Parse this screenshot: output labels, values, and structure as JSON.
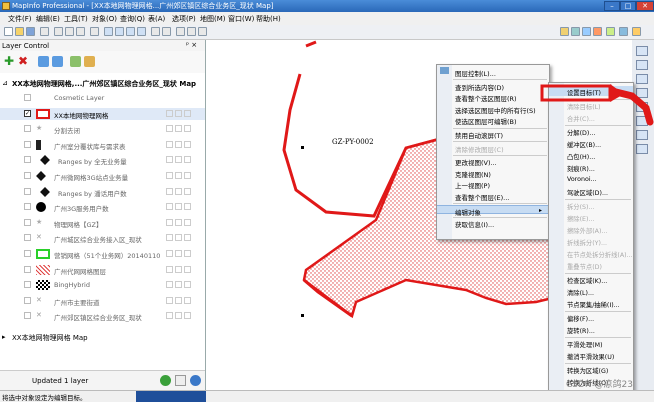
{
  "window": {
    "title": "MapInfo Professional - [XX本地网物理网格...广州郊区镇区综合业务区_现状 Map]",
    "min": "–",
    "max": "□",
    "close": "✕"
  },
  "menubar": [
    "文件(F)",
    "编辑(E)",
    "工具(T)",
    "对象(O)",
    "查询(Q)",
    "表(A)",
    "选项(P)",
    "地图(M)",
    "窗口(W)",
    "帮助(H)"
  ],
  "layer_control": {
    "title": "Layer Control",
    "pin": "ᵖ ×",
    "map1_title": "XX本地网物理网格,...广州郊区镇区综合业务区_现状 Map",
    "layers": [
      {
        "name": "Cosmetic Layer",
        "checked": false,
        "sym": "none",
        "color": "#999"
      },
      {
        "name": "XX本地网物理网格",
        "checked": true,
        "sym": "redrect",
        "selected": true
      },
      {
        "name": "分割去闭",
        "checked": false,
        "sym": "star"
      },
      {
        "name": "广州室分覆状库与需求表",
        "checked": false,
        "sym": "tower"
      },
      {
        "name": "Ranges by 全无业务量",
        "checked": false,
        "sym": "diamond",
        "indent": true
      },
      {
        "name": "广州微网格3G站点业务量",
        "checked": false,
        "sym": "diamond"
      },
      {
        "name": "Ranges by 潘话用户数",
        "checked": false,
        "sym": "diamond",
        "indent": true
      },
      {
        "name": "广州3G服务用户数",
        "checked": false,
        "sym": "circle"
      },
      {
        "name": "物理网格【GZ】",
        "checked": false,
        "sym": "star"
      },
      {
        "name": "广州城区综合业务接入区_现状",
        "checked": false,
        "sym": "cross"
      },
      {
        "name": "营销网格（51个业务网）20140110",
        "checked": false,
        "sym": "green"
      },
      {
        "name": "广州代网网格图层",
        "checked": false,
        "sym": "hatch"
      },
      {
        "name": "BingHybrid",
        "checked": false,
        "sym": "checker"
      },
      {
        "name": "广州市主要街道",
        "checked": false,
        "sym": "cross"
      },
      {
        "name": "广州郊区镇区综合业务区_现状",
        "checked": false,
        "sym": "cross"
      }
    ],
    "map2_title": "XX本地网物理网格 Map",
    "status": "Updated 1 layer"
  },
  "map": {
    "label": "GZ-PY-0002"
  },
  "context_menu": [
    {
      "label": "图层控制(L)..."
    },
    {
      "label": "查到所选内容(D)"
    },
    {
      "label": "查看整个选区图层(R)"
    },
    {
      "label": "选择选区图层中的所有行(S)"
    },
    {
      "label": "使选区图层可编辑(B)"
    },
    {
      "label": "禁用自动滚屏(T)"
    },
    {
      "label": "清除修改图层(C)",
      "disabled": true
    },
    {
      "label": "更改视图(V)..."
    },
    {
      "label": "克隆视图(N)"
    },
    {
      "label": "上一视图(P)"
    },
    {
      "label": "查看整个图层(E)..."
    },
    {
      "label": "编辑对象",
      "highlight": true,
      "arrow": "▸"
    },
    {
      "label": "获取信息(I)..."
    }
  ],
  "submenu": [
    {
      "label": "设置目标(T)",
      "highlight": true
    },
    {
      "label": "清除目标(L)",
      "disabled": true
    },
    {
      "label": "合并(C)...",
      "disabled": true
    },
    {
      "label": "分解(D)..."
    },
    {
      "label": "缓冲区(B)..."
    },
    {
      "label": "凸包(H)..."
    },
    {
      "label": "刻痕(R)..."
    },
    {
      "label": "Voronoi..."
    },
    {
      "label": "驾驶区域(D)..."
    },
    {
      "label": "拆分(S)...",
      "disabled": true
    },
    {
      "label": "擦除(E)...",
      "disabled": true
    },
    {
      "label": "擦除外部(A)...",
      "disabled": true
    },
    {
      "label": "折线拆分(Y)...",
      "disabled": true
    },
    {
      "label": "在节点处拆分折线(A)...",
      "disabled": true
    },
    {
      "label": "重叠节点(D)",
      "disabled": true
    },
    {
      "label": "检查区域(K)..."
    },
    {
      "label": "清除(L)..."
    },
    {
      "label": "节点聚集/抽稀(I)..."
    },
    {
      "label": "偏移(F)..."
    },
    {
      "label": "旋转(R)..."
    },
    {
      "label": "平滑处理(M)"
    },
    {
      "label": "撤消平滑效果(U)"
    },
    {
      "label": "转换为区域(G)"
    },
    {
      "label": "转换为折线(O)"
    }
  ],
  "statusbar": {
    "text": "将选中对象设定为编辑目标。"
  },
  "watermark": "CSDN @凉鸽23",
  "colors": {
    "accent": "#e01818",
    "menu_highlight": "#c7dcf3",
    "selection": "#3a78c8"
  }
}
